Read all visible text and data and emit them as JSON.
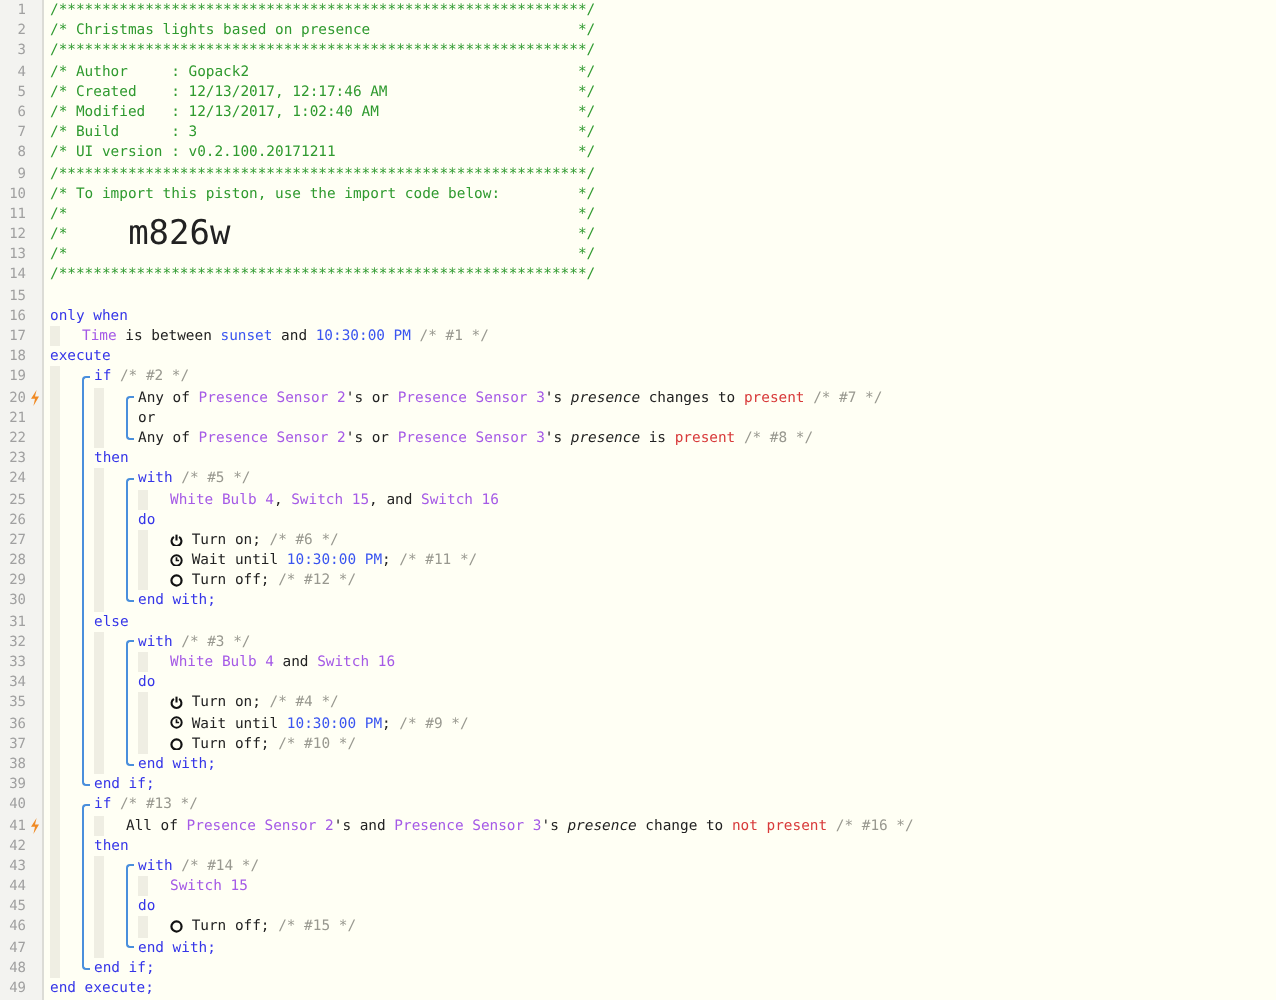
{
  "header": [
    {
      "number": "1",
      "tokens": [
        {
          "kind": "hdr",
          "text": "/*************************************************************/"
        }
      ]
    },
    {
      "number": "2",
      "tokens": [
        {
          "kind": "hdr",
          "text": "/* Christmas lights based on presence"
        },
        {
          "kind": "hdr",
          "text": "*/"
        }
      ]
    },
    {
      "number": "3",
      "tokens": [
        {
          "kind": "hdr",
          "text": "/*************************************************************/"
        }
      ]
    },
    {
      "number": "4",
      "tokens": [
        {
          "kind": "hdr",
          "text": "/* Author     : Gopack2"
        },
        {
          "kind": "hdr",
          "text": "*/"
        }
      ]
    },
    {
      "number": "5",
      "tokens": [
        {
          "kind": "hdr",
          "text": "/* Created    : 12/13/2017, 12:17:46 AM"
        },
        {
          "kind": "hdr",
          "text": "*/"
        }
      ]
    },
    {
      "number": "6",
      "tokens": [
        {
          "kind": "hdr",
          "text": "/* Modified   : 12/13/2017, 1:02:40 AM"
        },
        {
          "kind": "hdr",
          "text": "*/"
        }
      ]
    },
    {
      "number": "7",
      "tokens": [
        {
          "kind": "hdr",
          "text": "/* Build      : 3"
        },
        {
          "kind": "hdr",
          "text": "*/"
        }
      ]
    },
    {
      "number": "8",
      "tokens": [
        {
          "kind": "hdr",
          "text": "/* UI version : v0.2.100.20171211"
        },
        {
          "kind": "hdr",
          "text": "*/"
        }
      ]
    },
    {
      "number": "9",
      "tokens": [
        {
          "kind": "hdr",
          "text": "/*************************************************************/"
        }
      ]
    },
    {
      "number": "10",
      "tokens": [
        {
          "kind": "hdr",
          "text": "/* To import this piston, use the import code below:"
        },
        {
          "kind": "hdr",
          "text": "*/"
        }
      ]
    },
    {
      "number": "11",
      "tokens": [
        {
          "kind": "hdr",
          "text": "/*"
        },
        {
          "kind": "hdr",
          "text": "*/"
        }
      ]
    },
    {
      "number": "12",
      "tokens": [
        {
          "kind": "hdr",
          "text": "/*"
        },
        {
          "kind": "big",
          "text": "m826w"
        },
        {
          "kind": "hdr",
          "text": "*/"
        }
      ]
    },
    {
      "number": "13",
      "tokens": [
        {
          "kind": "hdr",
          "text": "/*"
        },
        {
          "kind": "hdr",
          "text": "*/"
        }
      ]
    },
    {
      "number": "14",
      "tokens": [
        {
          "kind": "hdr",
          "text": "/*************************************************************/"
        }
      ]
    }
  ],
  "code": [
    {
      "number": "15",
      "trigger": false
    },
    {
      "number": "16",
      "trigger": false,
      "tokens": [
        {
          "kind": "kw",
          "text": "only when"
        }
      ]
    },
    {
      "kind": "indent",
      "children": [
        {
          "number": "17",
          "trigger": false,
          "tokens": [
            {
              "kind": "dev",
              "text": "Time"
            },
            {
              "kind": "txt",
              "text": " is between "
            },
            {
              "kind": "val",
              "text": "sunset"
            },
            {
              "kind": "txt",
              "text": " and "
            },
            {
              "kind": "val",
              "text": "10:30:00 PM"
            },
            {
              "kind": "cmt",
              "text": "/* #1 */"
            }
          ]
        }
      ]
    },
    {
      "number": "18",
      "trigger": false,
      "tokens": [
        {
          "kind": "kw",
          "text": "execute"
        }
      ]
    },
    {
      "kind": "indent",
      "children": [
        {
          "kind": "block",
          "children": [
            {
              "number": "19",
              "trigger": false,
              "tokens": [
                {
                  "kind": "kw",
                  "text": "if"
                },
                {
                  "kind": "cmt",
                  "text": "/* #2 */"
                }
              ]
            },
            {
              "kind": "indent",
              "children": [
                {
                  "kind": "block",
                  "children": [
                    {
                      "number": "20",
                      "trigger": true,
                      "tokens": [
                        {
                          "kind": "txt",
                          "text": "Any of "
                        },
                        {
                          "kind": "dev",
                          "text": "Presence Sensor 2"
                        },
                        {
                          "kind": "txt",
                          "text": "'s or "
                        },
                        {
                          "kind": "dev",
                          "text": "Presence Sensor 3"
                        },
                        {
                          "kind": "txt",
                          "text": "'s "
                        },
                        {
                          "kind": "em",
                          "text": "presence"
                        },
                        {
                          "kind": "txt",
                          "text": " changes to "
                        },
                        {
                          "kind": "red",
                          "text": "present"
                        },
                        {
                          "kind": "cmt",
                          "text": "/* #7 */"
                        }
                      ]
                    },
                    {
                      "number": "21",
                      "trigger": false,
                      "tokens": [
                        {
                          "kind": "txt",
                          "text": "or"
                        }
                      ]
                    },
                    {
                      "number": "22",
                      "trigger": false,
                      "tokens": [
                        {
                          "kind": "txt",
                          "text": "Any of "
                        },
                        {
                          "kind": "dev",
                          "text": "Presence Sensor 2"
                        },
                        {
                          "kind": "txt",
                          "text": "'s or "
                        },
                        {
                          "kind": "dev",
                          "text": "Presence Sensor 3"
                        },
                        {
                          "kind": "txt",
                          "text": "'s "
                        },
                        {
                          "kind": "em",
                          "text": "presence"
                        },
                        {
                          "kind": "txt",
                          "text": " is "
                        },
                        {
                          "kind": "red",
                          "text": "present"
                        },
                        {
                          "kind": "cmt",
                          "text": "/* #8 */"
                        }
                      ]
                    }
                  ]
                }
              ]
            },
            {
              "number": "23",
              "trigger": false,
              "tokens": [
                {
                  "kind": "kw",
                  "text": "then"
                }
              ]
            },
            {
              "kind": "indent",
              "children": [
                {
                  "kind": "block",
                  "children": [
                    {
                      "number": "24",
                      "trigger": false,
                      "tokens": [
                        {
                          "kind": "kw",
                          "text": "with"
                        },
                        {
                          "kind": "cmt",
                          "text": "/* #5 */"
                        }
                      ]
                    },
                    {
                      "kind": "indent",
                      "children": [
                        {
                          "number": "25",
                          "trigger": false,
                          "tokens": [
                            {
                              "kind": "dev",
                              "text": "White Bulb 4"
                            },
                            {
                              "kind": "txt",
                              "text": ", "
                            },
                            {
                              "kind": "dev",
                              "text": "Switch 15"
                            },
                            {
                              "kind": "txt",
                              "text": ", and "
                            },
                            {
                              "kind": "dev",
                              "text": "Switch 16"
                            }
                          ]
                        }
                      ]
                    },
                    {
                      "number": "26",
                      "trigger": false,
                      "tokens": [
                        {
                          "kind": "kw",
                          "text": "do"
                        }
                      ]
                    },
                    {
                      "kind": "indent",
                      "children": [
                        {
                          "number": "27",
                          "trigger": false,
                          "tokens": [
                            {
                              "kind": "power"
                            },
                            {
                              "kind": "txt",
                              "text": "Turn on;"
                            },
                            {
                              "kind": "cmt",
                              "text": "/* #6 */"
                            }
                          ]
                        },
                        {
                          "number": "28",
                          "trigger": false,
                          "tokens": [
                            {
                              "kind": "clock"
                            },
                            {
                              "kind": "txt",
                              "text": "Wait until "
                            },
                            {
                              "kind": "val",
                              "text": "10:30:00 PM"
                            },
                            {
                              "kind": "txt",
                              "text": ";"
                            },
                            {
                              "kind": "cmt",
                              "text": "/* #11 */"
                            }
                          ]
                        },
                        {
                          "number": "29",
                          "trigger": false,
                          "tokens": [
                            {
                              "kind": "ring"
                            },
                            {
                              "kind": "txt",
                              "text": "Turn off;"
                            },
                            {
                              "kind": "cmt",
                              "text": "/* #12 */"
                            }
                          ]
                        }
                      ]
                    },
                    {
                      "number": "30",
                      "trigger": false,
                      "tokens": [
                        {
                          "kind": "kw",
                          "text": "end with;"
                        }
                      ]
                    }
                  ]
                }
              ]
            },
            {
              "number": "31",
              "trigger": false,
              "tokens": [
                {
                  "kind": "kw",
                  "text": "else"
                }
              ]
            },
            {
              "kind": "indent",
              "children": [
                {
                  "kind": "block",
                  "children": [
                    {
                      "number": "32",
                      "trigger": false,
                      "tokens": [
                        {
                          "kind": "kw",
                          "text": "with"
                        },
                        {
                          "kind": "cmt",
                          "text": "/* #3 */"
                        }
                      ]
                    },
                    {
                      "kind": "indent",
                      "children": [
                        {
                          "number": "33",
                          "trigger": false,
                          "tokens": [
                            {
                              "kind": "dev",
                              "text": "White Bulb 4"
                            },
                            {
                              "kind": "txt",
                              "text": " and "
                            },
                            {
                              "kind": "dev",
                              "text": "Switch 16"
                            }
                          ]
                        }
                      ]
                    },
                    {
                      "number": "34",
                      "trigger": false,
                      "tokens": [
                        {
                          "kind": "kw",
                          "text": "do"
                        }
                      ]
                    },
                    {
                      "kind": "indent",
                      "children": [
                        {
                          "number": "35",
                          "trigger": false,
                          "tokens": [
                            {
                              "kind": "power"
                            },
                            {
                              "kind": "txt",
                              "text": "Turn on;"
                            },
                            {
                              "kind": "cmt",
                              "text": "/* #4 */"
                            }
                          ]
                        },
                        {
                          "number": "36",
                          "trigger": false,
                          "tokens": [
                            {
                              "kind": "clock"
                            },
                            {
                              "kind": "txt",
                              "text": "Wait until "
                            },
                            {
                              "kind": "val",
                              "text": "10:30:00 PM"
                            },
                            {
                              "kind": "txt",
                              "text": ";"
                            },
                            {
                              "kind": "cmt",
                              "text": "/* #9 */"
                            }
                          ]
                        },
                        {
                          "number": "37",
                          "trigger": false,
                          "tokens": [
                            {
                              "kind": "ring"
                            },
                            {
                              "kind": "txt",
                              "text": "Turn off;"
                            },
                            {
                              "kind": "cmt",
                              "text": "/* #10 */"
                            }
                          ]
                        }
                      ]
                    },
                    {
                      "number": "38",
                      "trigger": false,
                      "tokens": [
                        {
                          "kind": "kw",
                          "text": "end with;"
                        }
                      ]
                    }
                  ]
                }
              ]
            },
            {
              "number": "39",
              "trigger": false,
              "tokens": [
                {
                  "kind": "kw",
                  "text": "end if;"
                }
              ]
            }
          ]
        },
        {
          "kind": "block",
          "children": [
            {
              "number": "40",
              "trigger": false,
              "tokens": [
                {
                  "kind": "kw",
                  "text": "if"
                },
                {
                  "kind": "cmt",
                  "text": "/* #13 */"
                }
              ]
            },
            {
              "kind": "indent",
              "children": [
                {
                  "number": "41",
                  "trigger": true,
                  "tokens": [
                    {
                      "kind": "txt",
                      "text": "All of "
                    },
                    {
                      "kind": "dev",
                      "text": "Presence Sensor 2"
                    },
                    {
                      "kind": "txt",
                      "text": "'s and "
                    },
                    {
                      "kind": "dev",
                      "text": "Presence Sensor 3"
                    },
                    {
                      "kind": "txt",
                      "text": "'s "
                    },
                    {
                      "kind": "em",
                      "text": "presence"
                    },
                    {
                      "kind": "txt",
                      "text": " change to "
                    },
                    {
                      "kind": "red",
                      "text": "not present"
                    },
                    {
                      "kind": "cmt",
                      "text": "/* #16 */"
                    }
                  ]
                }
              ]
            },
            {
              "number": "42",
              "trigger": false,
              "tokens": [
                {
                  "kind": "kw",
                  "text": "then"
                }
              ]
            },
            {
              "kind": "indent",
              "children": [
                {
                  "kind": "block",
                  "children": [
                    {
                      "number": "43",
                      "trigger": false,
                      "tokens": [
                        {
                          "kind": "kw",
                          "text": "with"
                        },
                        {
                          "kind": "cmt",
                          "text": "/* #14 */"
                        }
                      ]
                    },
                    {
                      "kind": "indent",
                      "children": [
                        {
                          "number": "44",
                          "trigger": false,
                          "tokens": [
                            {
                              "kind": "dev",
                              "text": "Switch 15"
                            }
                          ]
                        }
                      ]
                    },
                    {
                      "number": "45",
                      "trigger": false,
                      "tokens": [
                        {
                          "kind": "kw",
                          "text": "do"
                        }
                      ]
                    },
                    {
                      "kind": "indent",
                      "children": [
                        {
                          "number": "46",
                          "trigger": false,
                          "tokens": [
                            {
                              "kind": "ring"
                            },
                            {
                              "kind": "txt",
                              "text": "Turn off;"
                            },
                            {
                              "kind": "cmt",
                              "text": "/* #15 */"
                            }
                          ]
                        }
                      ]
                    },
                    {
                      "number": "47",
                      "trigger": false,
                      "tokens": [
                        {
                          "kind": "kw",
                          "text": "end with;"
                        }
                      ]
                    }
                  ]
                }
              ]
            },
            {
              "number": "48",
              "trigger": false,
              "tokens": [
                {
                  "kind": "kw",
                  "text": "end if;"
                }
              ]
            }
          ]
        }
      ]
    },
    {
      "number": "49",
      "trigger": false,
      "tokens": [
        {
          "kind": "kw",
          "text": "end execute;"
        }
      ]
    }
  ]
}
